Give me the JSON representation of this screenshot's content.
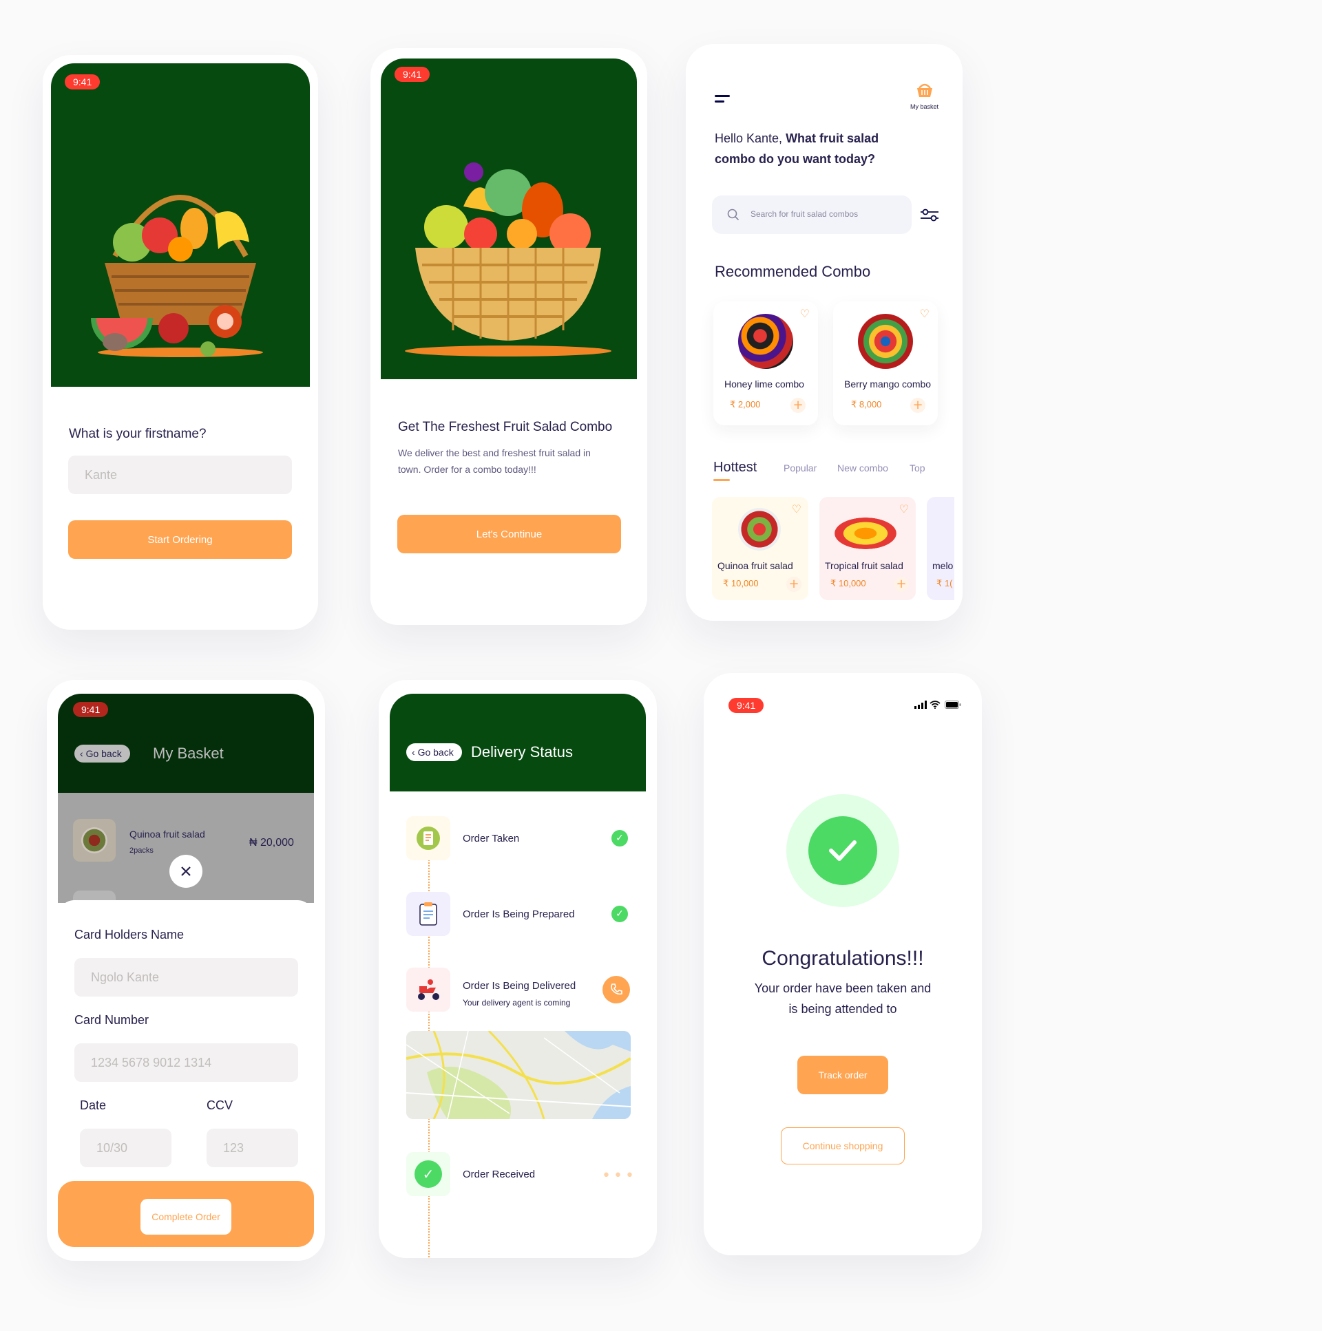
{
  "status_time": "9:41",
  "screen1": {
    "question": "What is your firstname?",
    "input_placeholder": "Kante",
    "button": "Start Ordering"
  },
  "screen2": {
    "title": "Get The Freshest Fruit Salad Combo",
    "body": "We deliver the best and freshest fruit salad in town. Order for a combo today!!!",
    "button": "Let's Continue"
  },
  "screen3": {
    "basket_label": "My basket",
    "greeting_name": "Hello Kante, ",
    "greeting_rest": "What fruit salad combo do you want today?",
    "search_placeholder": "Search for fruit salad combos",
    "recommended_title": "Recommended Combo",
    "recommended": [
      {
        "name": "Honey lime combo",
        "price": "₹ 2,000"
      },
      {
        "name": "Berry mango combo",
        "price": "₹ 8,000"
      }
    ],
    "tabs": [
      "Hottest",
      "Popular",
      "New combo",
      "Top"
    ],
    "hottest": [
      {
        "name": "Quinoa fruit salad",
        "price": "₹ 10,000"
      },
      {
        "name": "Tropical fruit salad",
        "price": "₹ 10,000"
      },
      {
        "name": "melo",
        "price": "₹ 1("
      }
    ]
  },
  "screen4": {
    "go_back": "Go back",
    "title": "My Basket",
    "item_name": "Quinoa fruit salad",
    "item_packs": "2packs",
    "item_price": "₦ 20,000",
    "card_holder_label": "Card Holders Name",
    "card_holder_placeholder": "Ngolo Kante",
    "card_number_label": "Card Number",
    "card_number_placeholder": "1234 5678 9012 1314",
    "date_label": "Date",
    "date_placeholder": "10/30",
    "ccv_label": "CCV",
    "ccv_placeholder": "123",
    "button": "Complete Order"
  },
  "screen5": {
    "go_back": "Go back",
    "title": "Delivery Status",
    "steps": [
      {
        "title": "Order Taken",
        "subtitle": ""
      },
      {
        "title": "Order Is Being Prepared",
        "subtitle": ""
      },
      {
        "title": "Order Is Being Delivered",
        "subtitle": "Your delivery agent is coming"
      },
      {
        "title": "Order Received",
        "subtitle": ""
      }
    ]
  },
  "screen6": {
    "title": "Congratulations!!!",
    "message_line1": "Your order have been taken and",
    "message_line2": "is being attended to",
    "track_button": "Track order",
    "continue_button": "Continue shopping"
  },
  "colors": {
    "primary_orange": "#ffa451",
    "dark_green": "#064a10",
    "success_green": "#4cd964",
    "text_dark": "#27214d"
  }
}
